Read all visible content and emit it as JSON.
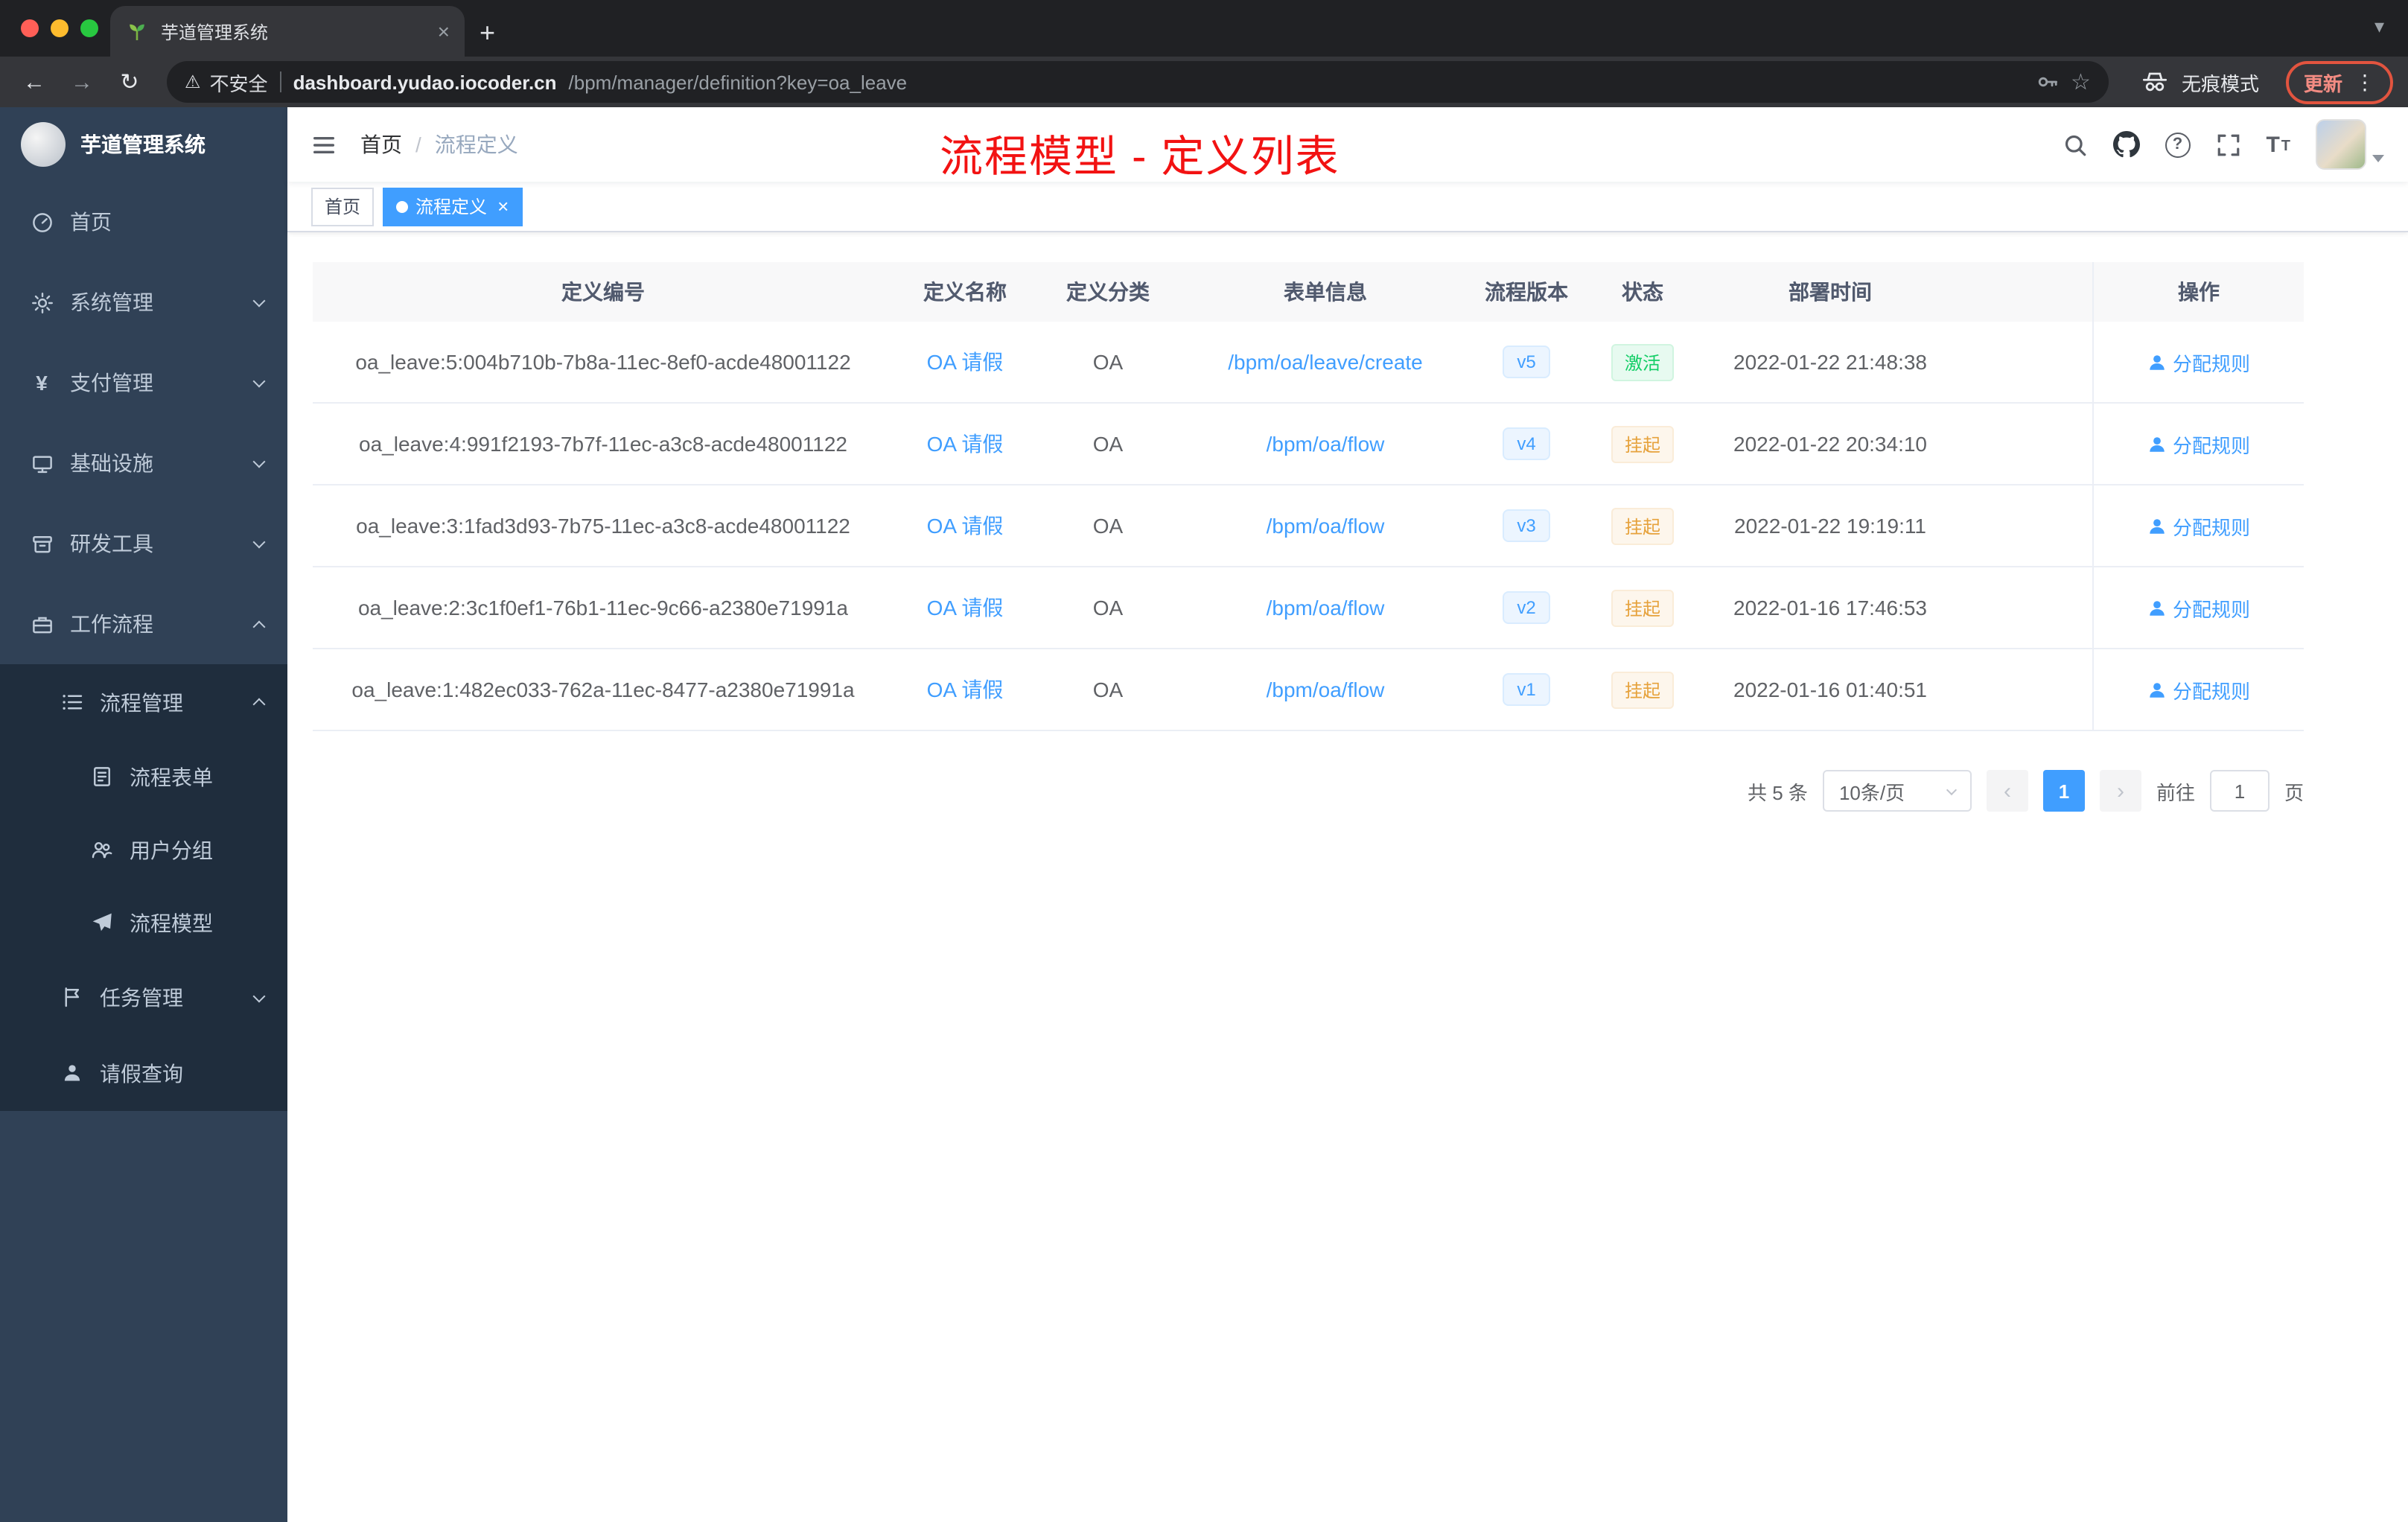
{
  "colors": {
    "accent": "#409eff",
    "success": "#13ce66",
    "warning": "#e6a23c",
    "annotation_red": "#f21212",
    "sidebar_bg": "#304156",
    "submenu_bg": "#1f2d3d"
  },
  "glyphs": {
    "close": "×",
    "plus": "+",
    "caret_down": "▾",
    "back": "←",
    "forward": "→",
    "reload": "↻",
    "warning": "⚠",
    "star": "☆",
    "dots": "⋮",
    "yen": "¥",
    "slash": "/",
    "question": "?",
    "letter_t": "T",
    "prev": "‹",
    "next": "›"
  },
  "browser": {
    "tab_title": "芋道管理系统",
    "security_label": "不安全",
    "url_domain": "dashboard.yudao.iocoder.cn",
    "url_path": "/bpm/manager/definition?key=oa_leave",
    "incognito_label": "无痕模式",
    "update_label": "更新"
  },
  "sidebar": {
    "logo_title": "芋道管理系统",
    "menu": [
      {
        "label": "首页"
      },
      {
        "label": "系统管理"
      },
      {
        "label": "支付管理"
      },
      {
        "label": "基础设施"
      },
      {
        "label": "研发工具"
      },
      {
        "label": "工作流程"
      },
      {
        "label": "流程管理"
      },
      {
        "label": "流程表单"
      },
      {
        "label": "用户分组"
      },
      {
        "label": "流程模型"
      },
      {
        "label": "任务管理"
      },
      {
        "label": "请假查询"
      }
    ]
  },
  "header": {
    "breadcrumb": [
      "首页",
      "流程定义"
    ],
    "annotation": "流程模型 - 定义列表"
  },
  "tags": [
    {
      "label": "首页",
      "active": false
    },
    {
      "label": "流程定义",
      "active": true
    }
  ],
  "table": {
    "columns": [
      "定义编号",
      "定义名称",
      "定义分类",
      "表单信息",
      "流程版本",
      "状态",
      "部署时间",
      "操作"
    ],
    "rows": [
      {
        "id": "oa_leave:5:004b710b-7b8a-11ec-8ef0-acde48001122",
        "name": "OA 请假",
        "category": "OA",
        "form": "/bpm/oa/leave/create",
        "version": "v5",
        "status": "激活",
        "status_type": "success",
        "time": "2022-01-22 21:48:38",
        "action": "分配规则"
      },
      {
        "id": "oa_leave:4:991f2193-7b7f-11ec-a3c8-acde48001122",
        "name": "OA 请假",
        "category": "OA",
        "form": "/bpm/oa/flow",
        "version": "v4",
        "status": "挂起",
        "status_type": "warning",
        "time": "2022-01-22 20:34:10",
        "action": "分配规则"
      },
      {
        "id": "oa_leave:3:1fad3d93-7b75-11ec-a3c8-acde48001122",
        "name": "OA 请假",
        "category": "OA",
        "form": "/bpm/oa/flow",
        "version": "v3",
        "status": "挂起",
        "status_type": "warning",
        "time": "2022-01-22 19:19:11",
        "action": "分配规则"
      },
      {
        "id": "oa_leave:2:3c1f0ef1-76b1-11ec-9c66-a2380e71991a",
        "name": "OA 请假",
        "category": "OA",
        "form": "/bpm/oa/flow",
        "version": "v2",
        "status": "挂起",
        "status_type": "warning",
        "time": "2022-01-16 17:46:53",
        "action": "分配规则"
      },
      {
        "id": "oa_leave:1:482ec033-762a-11ec-8477-a2380e71991a",
        "name": "OA 请假",
        "category": "OA",
        "form": "/bpm/oa/flow",
        "version": "v1",
        "status": "挂起",
        "status_type": "warning",
        "time": "2022-01-16 01:40:51",
        "action": "分配规则"
      }
    ]
  },
  "pagination": {
    "total": "共 5 条",
    "page_size": "10条/页",
    "current_page": "1",
    "goto_label": "前往",
    "goto_value": "1",
    "page_unit": "页"
  }
}
